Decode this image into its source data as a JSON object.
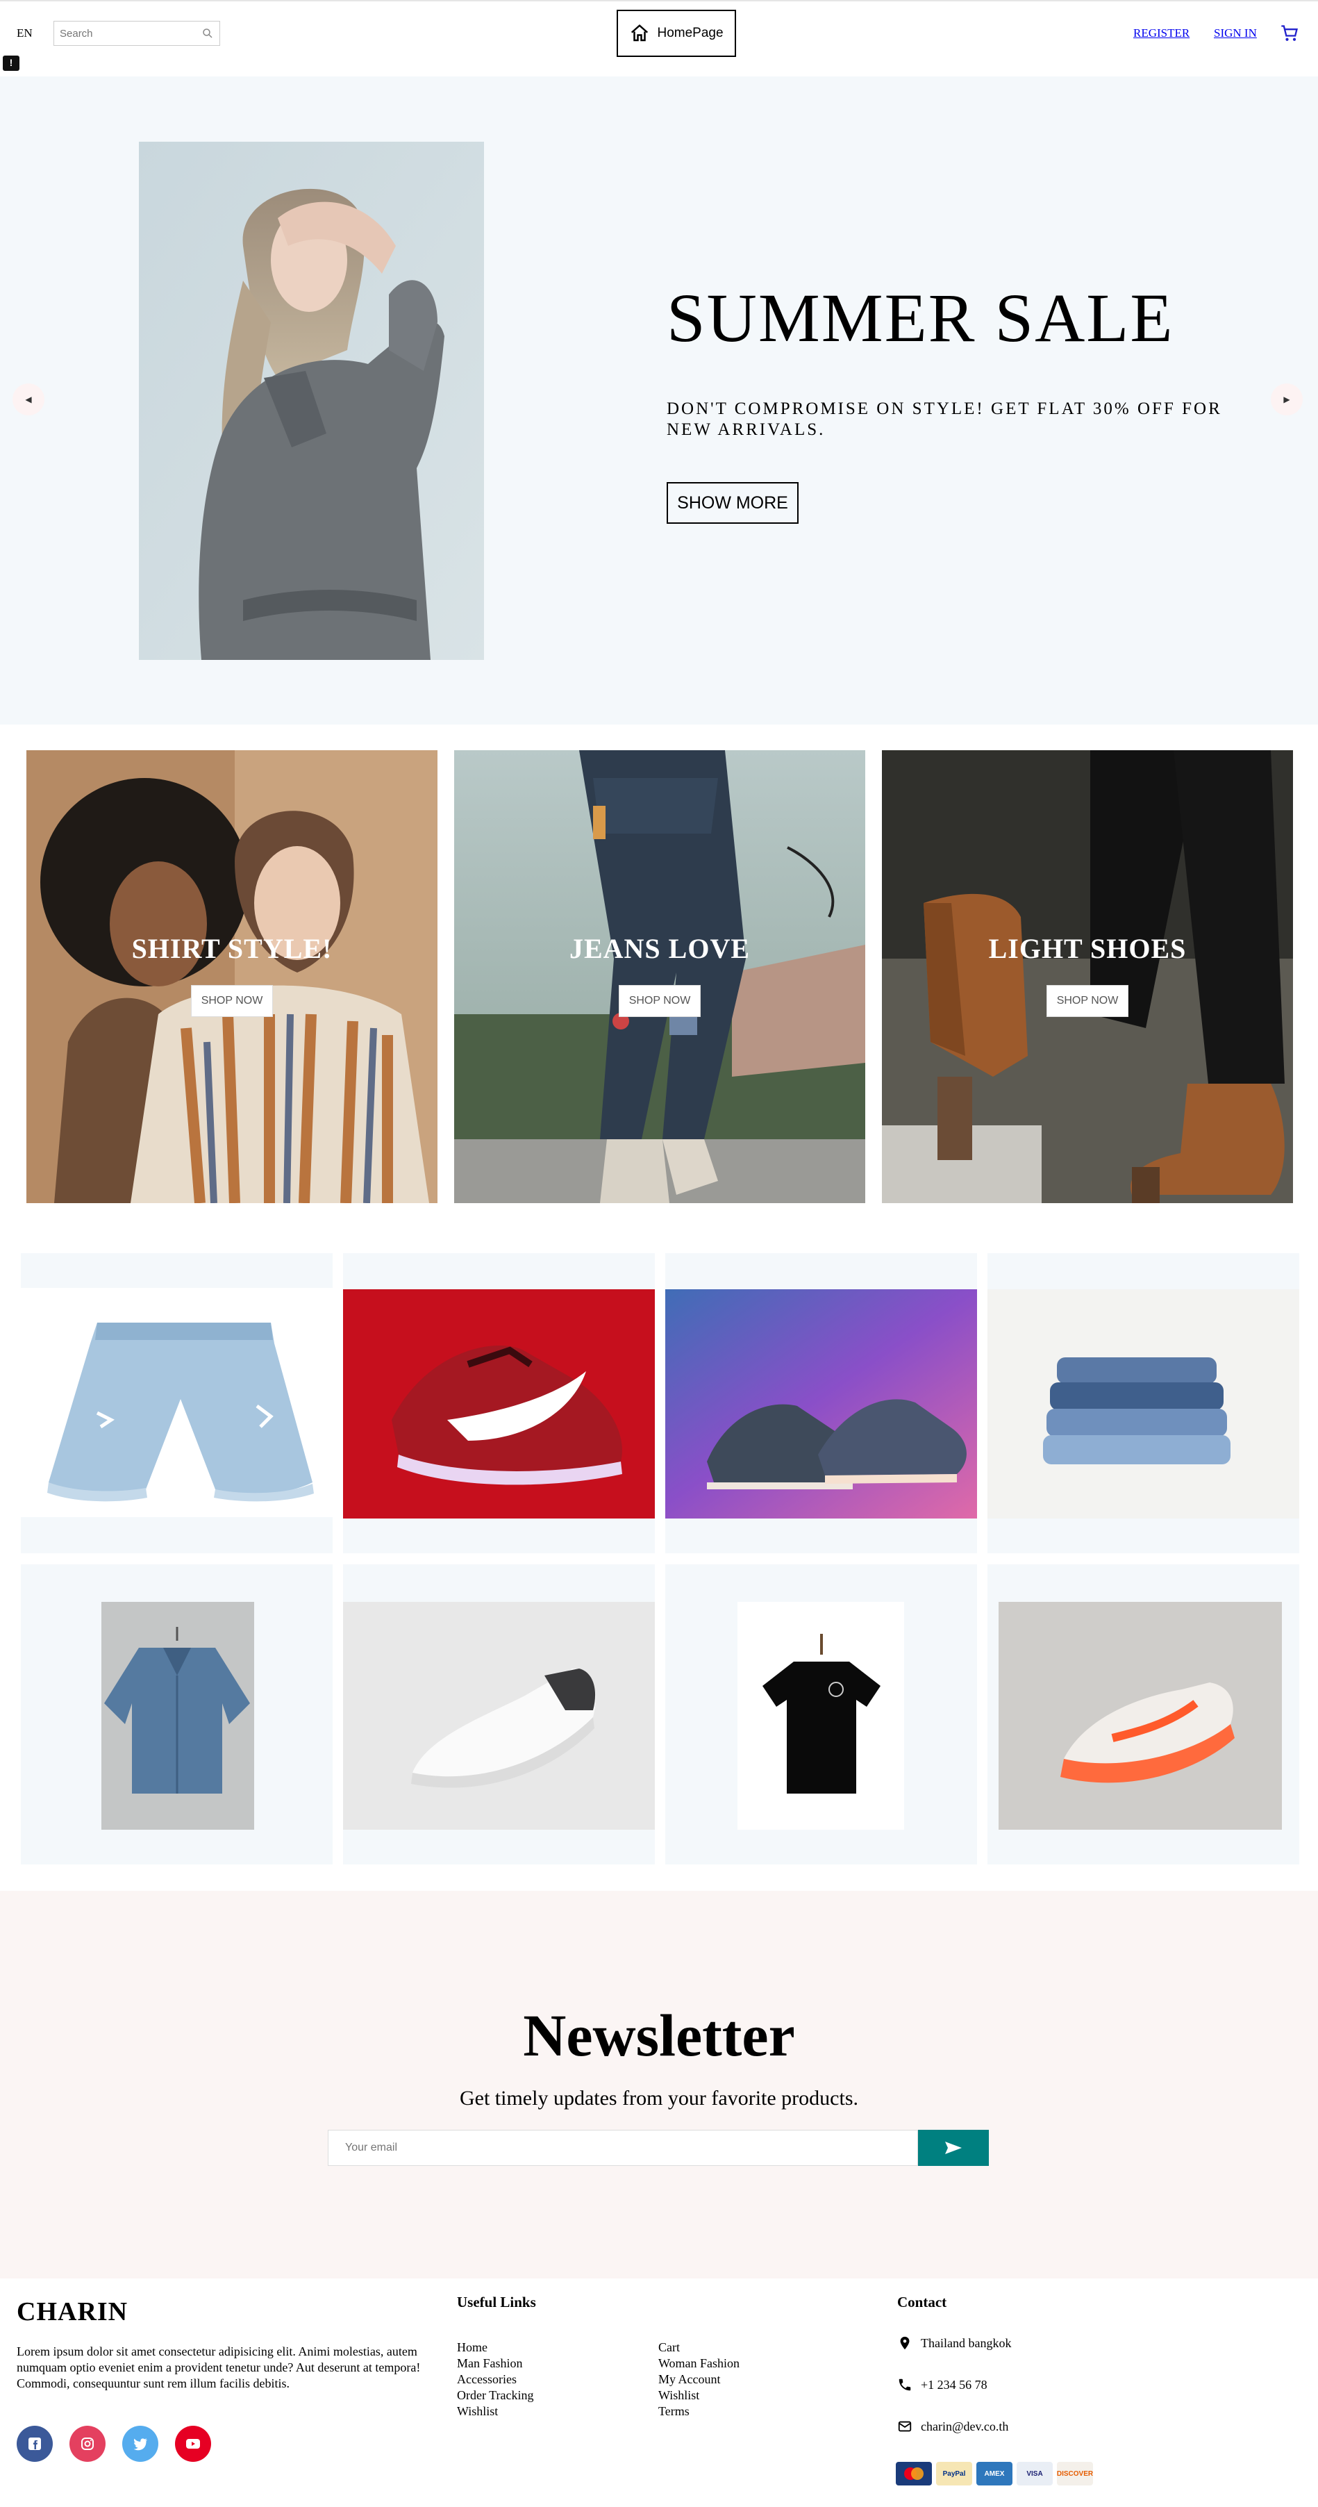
{
  "header": {
    "language": "EN",
    "search_placeholder": "Search",
    "home_label": "HomePage",
    "register_label": "REGISTER",
    "signin_label": "SIGN IN",
    "feedback_label": "!"
  },
  "hero": {
    "title": "SUMMER SALE",
    "description": "DON'T COMPROMISE ON STYLE! GET FLAT 30% OFF FOR NEW ARRIVALS.",
    "button_label": "SHOW MORE",
    "prev_arrow": "◀",
    "next_arrow": "▶"
  },
  "categories": [
    {
      "title": "SHIRT STYLE!",
      "button_label": "SHOP NOW"
    },
    {
      "title": "JEANS LOVE",
      "button_label": "SHOP NOW"
    },
    {
      "title": "LIGHT SHOES",
      "button_label": "SHOP NOW"
    }
  ],
  "products": [
    {
      "name": "denim-shorts-product"
    },
    {
      "name": "red-sneaker-product"
    },
    {
      "name": "neon-sneakers-product"
    },
    {
      "name": "folded-jeans-product"
    },
    {
      "name": "denim-shirt-product"
    },
    {
      "name": "white-sneaker-product"
    },
    {
      "name": "black-tshirt-product"
    },
    {
      "name": "orange-sneaker-product"
    }
  ],
  "newsletter": {
    "title": "Newsletter",
    "description": "Get timely updates from your favorite products.",
    "email_placeholder": "Your email"
  },
  "footer": {
    "brand": "CHARIN",
    "brand_description": "Lorem ipsum dolor sit amet consectetur adipisicing elit. Animi molestias, autem numquam optio eveniet enim a provident tenetur unde? Aut deserunt at tempora! Commodi, consequuntur sunt rem illum facilis debitis.",
    "useful_links_title": "Useful Links",
    "links_col1": [
      "Home",
      "Man Fashion",
      "Accessories",
      "Order Tracking",
      "Wishlist"
    ],
    "links_col2": [
      "Cart",
      "Woman Fashion",
      "My Account",
      "Wishlist",
      "Terms"
    ],
    "contact_title": "Contact",
    "address": "Thailand bangkok",
    "phone": "+1 234 56 78",
    "email": "charin@dev.co.th",
    "payments": [
      "MasterCard",
      "PayPal",
      "AMEX",
      "VISA",
      "DISCOVER"
    ]
  },
  "colors": {
    "hero_bg": "#f4f8fb",
    "newsletter_bg": "#fbf5f4",
    "accent_teal": "#008080",
    "link_blue": "#0000ee",
    "facebook": "#3b5999",
    "instagram": "#e4405f",
    "twitter": "#55acee",
    "youtube": "#e60023"
  }
}
